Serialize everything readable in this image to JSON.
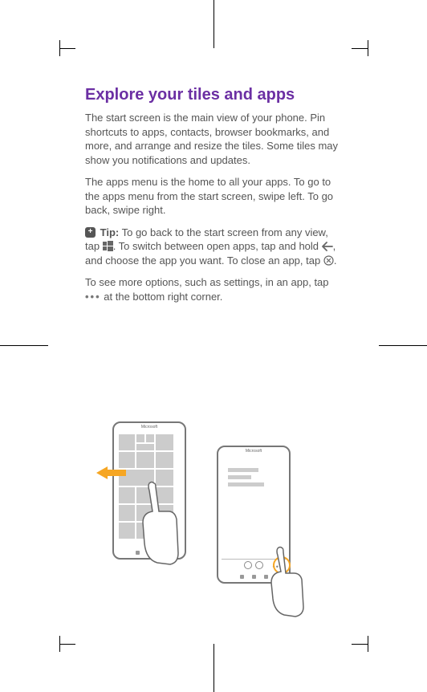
{
  "title": "Explore your tiles and apps",
  "para1": "The start screen is the main view of your phone. Pin shortcuts to apps, contacts, browser bookmarks, and more, and arrange and resize the tiles. Some tiles may show you notifications and updates.",
  "para2": "The apps menu is the home to all your apps. To go to the apps menu from the start screen, swipe left. To go back, swipe right.",
  "tipLabel": "Tip:",
  "tipPart1": "To go back to the start screen from any view, tap ",
  "tipPart2": ". To switch between open apps, tap and hold ",
  "tipPart3": ", and choose the app you want. To close an app, tap ",
  "tipPart4": ".",
  "para4a": "To see more options, such as settings, in an app, tap ",
  "para4b": " at the bottom right corner.",
  "brand": "Microsoft",
  "icons": {
    "tip": "tip-icon",
    "windows": "windows-icon",
    "back": "back-arrow-icon",
    "close": "close-circle-icon",
    "more": "more-dots-icon"
  },
  "colors": {
    "heading": "#6b2fa3",
    "highlight": "#f6a623"
  }
}
